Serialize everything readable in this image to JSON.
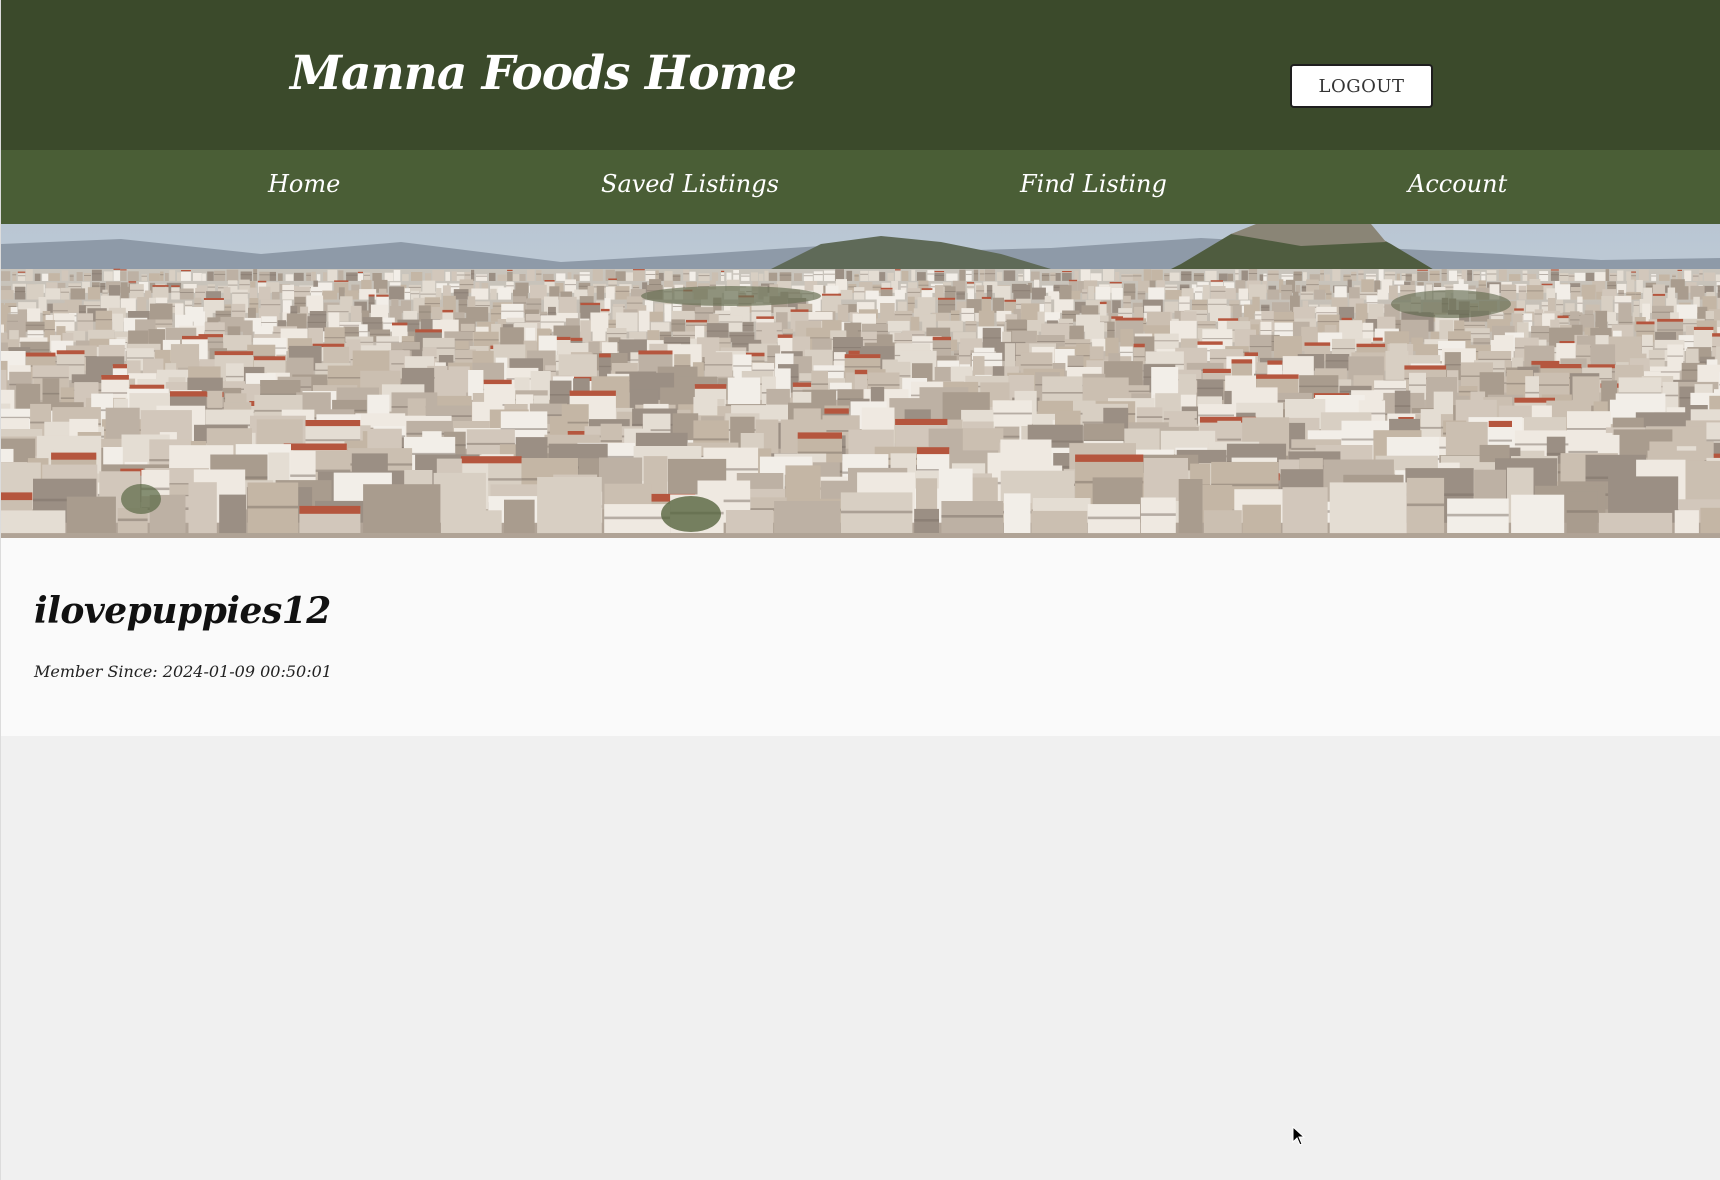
{
  "header": {
    "title": "Manna Foods Home",
    "logout_label": "LOGOUT"
  },
  "nav": {
    "items": [
      {
        "label": "Home"
      },
      {
        "label": "Saved Listings"
      },
      {
        "label": "Find Listing"
      },
      {
        "label": "Account"
      }
    ]
  },
  "hero": {
    "image": "city-panorama"
  },
  "profile": {
    "username": "ilovepuppies12",
    "member_since": "Member Since: 2024-01-09 00:50:01"
  },
  "colors": {
    "header_bg": "#3b4a2b",
    "nav_bg": "#4a5e36",
    "page_bg": "#f0f0f0",
    "profile_bg": "#fafafa"
  },
  "icons": {
    "cursor": "mouse-pointer-icon"
  }
}
